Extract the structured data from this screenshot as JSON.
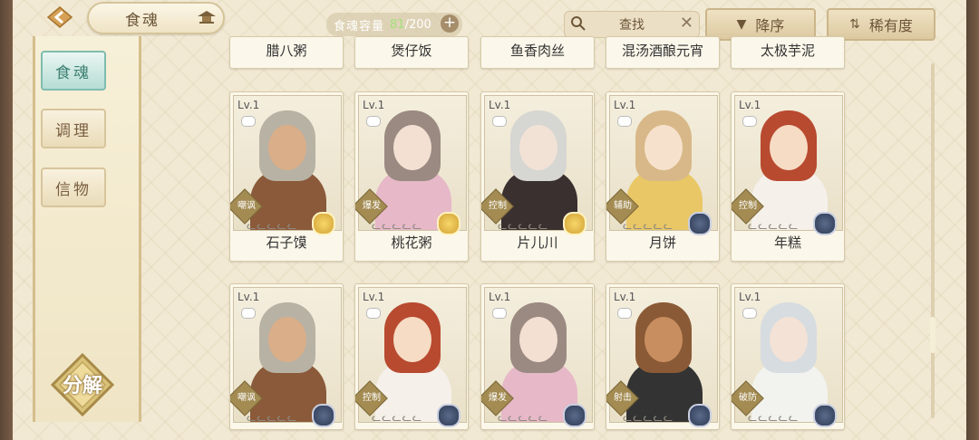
{
  "header": {
    "title": "食魂",
    "capacity_label": "食魂容量",
    "capacity_current": "81",
    "capacity_sep": "/",
    "capacity_max": "200",
    "capacity_plus": "+",
    "search_text": "查找",
    "search_clear": "✕",
    "sort_order": "降序",
    "sort_rarity": "稀有度"
  },
  "sidebar": {
    "tabs": [
      {
        "label": "食魂",
        "active": true
      },
      {
        "label": "调理",
        "active": false
      },
      {
        "label": "信物",
        "active": false
      }
    ],
    "decompose_label": "分解"
  },
  "top_row_names": [
    "腊八粥",
    "煲仔饭",
    "鱼香肉丝",
    "混汤酒酿元宵",
    "太极芋泥"
  ],
  "cards": [
    {
      "lv": "Lv.1",
      "role": "嘲讽",
      "name": "石子馍",
      "stars": "ᓚᓚᓚᓚᓚ",
      "medal": "gold",
      "hair": "#b8b2a4",
      "skin": "#d9ae88",
      "outfit": "#8a5a3a"
    },
    {
      "lv": "Lv.1",
      "role": "爆发",
      "name": "桃花粥",
      "stars": "ᓚᓚᓚᓚᓚ",
      "medal": "gold",
      "hair": "#9a8a82",
      "skin": "#f4e0d2",
      "outfit": "#e6b8c8"
    },
    {
      "lv": "Lv.1",
      "role": "控制",
      "name": "片儿川",
      "stars": "ᓚᓚᓚᓚᓚ",
      "medal": "gold",
      "hair": "#d6d6d2",
      "skin": "#f2e2d6",
      "outfit": "#3a3030"
    },
    {
      "lv": "Lv.1",
      "role": "辅助",
      "name": "月饼",
      "stars": "ᓚᓚᓚᓚᓚ",
      "medal": "navy",
      "hair": "#d8b888",
      "skin": "#f6e2cc",
      "outfit": "#e9c766"
    },
    {
      "lv": "Lv.1",
      "role": "控制",
      "name": "年糕",
      "stars": "ᓚᓚᓚᓚᓚ",
      "medal": "navy",
      "hair": "#b84a30",
      "skin": "#f6dcc4",
      "outfit": "#f5f0ea"
    },
    {
      "lv": "Lv.1",
      "role": "嘲讽",
      "name": "",
      "stars": "ᓚᓚᓚᓚᓚ",
      "medal": "navy",
      "hair": "#b8b2a4",
      "skin": "#d9ae88",
      "outfit": "#8a5a3a"
    },
    {
      "lv": "Lv.1",
      "role": "控制",
      "name": "",
      "stars": "ᓚᓚᓚᓚᓚ",
      "medal": "navy",
      "hair": "#b84a30",
      "skin": "#f6dcc4",
      "outfit": "#f5f0ea"
    },
    {
      "lv": "Lv.1",
      "role": "爆发",
      "name": "",
      "stars": "ᓚᓚᓚᓚᓚ",
      "medal": "navy",
      "hair": "#9a8a82",
      "skin": "#f4e0d2",
      "outfit": "#e6b8c8"
    },
    {
      "lv": "Lv.1",
      "role": "射击",
      "name": "",
      "stars": "ᓚᓚᓚᓚᓚ",
      "medal": "navy",
      "hair": "#8a5a36",
      "skin": "#c98e60",
      "outfit": "#333333"
    },
    {
      "lv": "Lv.1",
      "role": "破防",
      "name": "",
      "stars": "ᓚᓚᓚᓚᓚ",
      "medal": "navy",
      "hair": "#d6dce0",
      "skin": "#f4e2d6",
      "outfit": "#f2f2ee"
    }
  ]
}
